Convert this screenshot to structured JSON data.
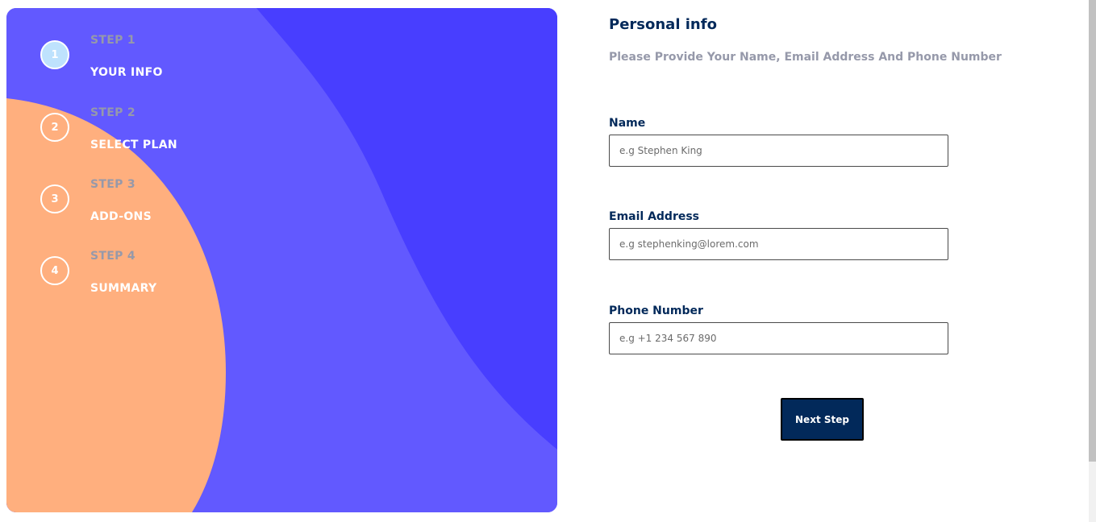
{
  "sidebar": {
    "steps": [
      {
        "number": "1",
        "caption": "STEP 1",
        "title": "YOUR INFO",
        "active": true
      },
      {
        "number": "2",
        "caption": "STEP 2",
        "title": "SELECT PLAN",
        "active": false
      },
      {
        "number": "3",
        "caption": "STEP 3",
        "title": "ADD-ONS",
        "active": false
      },
      {
        "number": "4",
        "caption": "STEP 4",
        "title": "SUMMARY",
        "active": false
      }
    ]
  },
  "form": {
    "title": "Personal info",
    "subtitle": "Please Provide Your Name, Email Address And Phone Number",
    "fields": {
      "name": {
        "label": "Name",
        "placeholder": "e.g Stephen King",
        "value": ""
      },
      "email": {
        "label": "Email Address",
        "placeholder": "e.g stephenking@lorem.com",
        "value": ""
      },
      "phone": {
        "label": "Phone Number",
        "placeholder": "e.g +1 234 567 890",
        "value": ""
      }
    },
    "next_label": "Next Step"
  },
  "colors": {
    "sidebar_base": "#6259ff",
    "sidebar_wave": "#483eff",
    "sidebar_circle": "#ffaf7e",
    "active_step": "#bee2fd",
    "marine_blue": "#02295a",
    "cool_gray": "#9699aa"
  }
}
